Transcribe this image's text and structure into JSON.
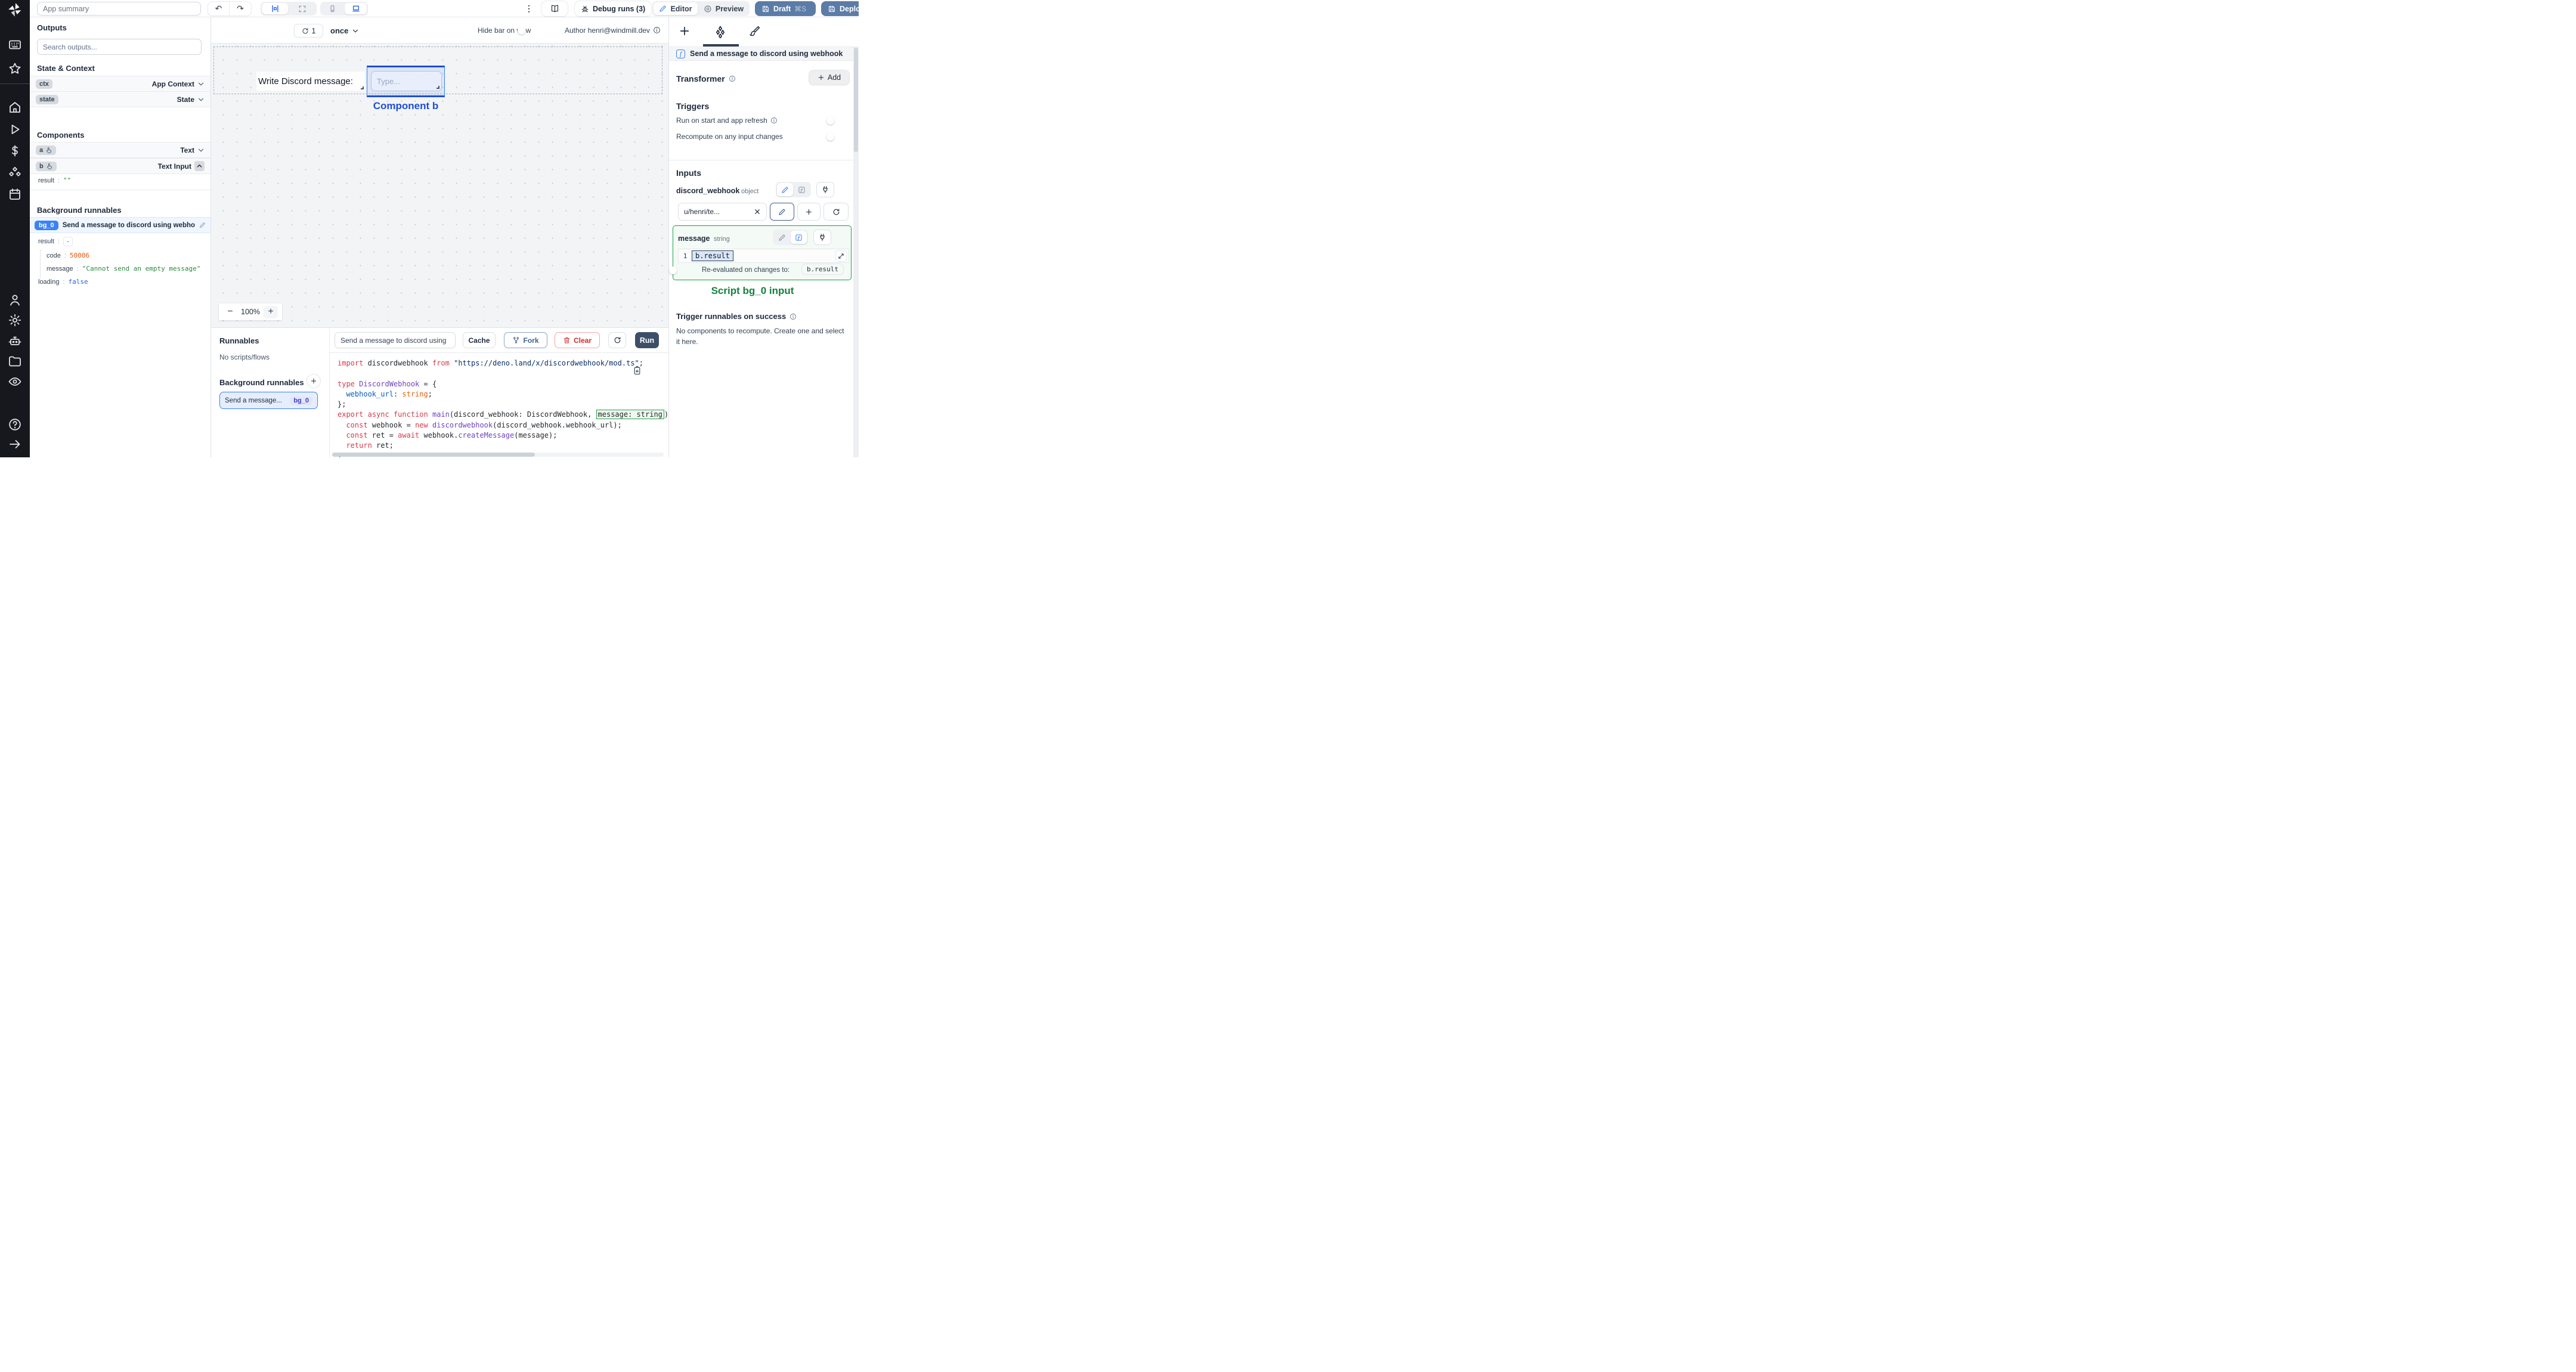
{
  "colors": {
    "accent_blue": "#2563eb",
    "selection_blue": "#1d4ed8",
    "success_green": "#15803d",
    "draft_deploy_button": "#5b7ca6",
    "run_button": "#3d4f68",
    "error_orange": "#e8590c",
    "string_green": "#2b8a3e",
    "bool_blue": "#2563eb",
    "badge_blue": "#3b82f6",
    "sidebar_bg": "#16181d"
  },
  "sidebar": {
    "icons": [
      "windmill-logo",
      "keyboard",
      "star",
      "home",
      "play",
      "dollar",
      "cubes",
      "calendar",
      "person",
      "gear",
      "robot",
      "folder",
      "eye",
      "help",
      "arrow-right"
    ]
  },
  "topbar": {
    "app_summary_placeholder": "App summary",
    "debug_runs_label": "Debug runs (3)",
    "editor_label": "Editor",
    "preview_label": "Preview",
    "draft_label": "Draft",
    "draft_shortcut": "⌘S",
    "deploy_label": "Deploy"
  },
  "outputs": {
    "title": "Outputs",
    "search_placeholder": "Search outputs...",
    "state_context_title": "State & Context",
    "ctx_badge": "ctx",
    "ctx_type": "App Context",
    "state_badge": "state",
    "state_type": "State",
    "components_title": "Components",
    "comp_a_badge": "a",
    "comp_a_type": "Text",
    "comp_b_badge": "b",
    "comp_b_type": "Text Input",
    "comp_b_result_key": "result",
    "comp_b_result_value": "\"\"",
    "background_title": "Background runnables",
    "bg0_badge": "bg_0",
    "bg0_name": "Send a message to discord using webhook",
    "bg0_result_key": "result",
    "bg0_collapse": "-",
    "bg0_code_key": "code",
    "bg0_code_value": "50006",
    "bg0_message_key": "message",
    "bg0_message_value": "\"Cannot send an empty message\"",
    "bg0_loading_key": "loading",
    "bg0_loading_value": "false"
  },
  "canvas": {
    "refresh_count": "1",
    "frequency": "once",
    "hide_bar_label": "Hide bar on view",
    "author_label": "Author henri@windmill.dev",
    "text_component_value": "Write Discord message:",
    "input_placeholder": "Type...",
    "selected_component_label": "Component b",
    "zoom_minus": "−",
    "zoom_level": "100%",
    "zoom_plus": "+"
  },
  "runnables": {
    "title": "Runnables",
    "empty_label": "No scripts/flows",
    "background_title": "Background runnables",
    "item_name": "Send a message...",
    "item_badge": "bg_0"
  },
  "script_editor": {
    "name_value": "Send a message to discord using",
    "cache_label": "Cache",
    "fork_label": "Fork",
    "clear_label": "Clear",
    "run_label": "Run",
    "code_lines": [
      [
        [
          "k",
          "import"
        ],
        [
          "p",
          " discordwebhook "
        ],
        [
          "k",
          "from"
        ],
        [
          "p",
          " "
        ],
        [
          "s",
          "\"https://deno.land/x/discordwebhook/mod.ts\""
        ],
        [
          "p",
          ";"
        ]
      ],
      [],
      [
        [
          "k",
          "type"
        ],
        [
          "p",
          " "
        ],
        [
          "v",
          "DiscordWebhook"
        ],
        [
          "p",
          " = {"
        ]
      ],
      [
        [
          "p",
          "  "
        ],
        [
          "b",
          "webhook_url"
        ],
        [
          "p",
          ": "
        ],
        [
          "t",
          "string"
        ],
        [
          "p",
          ";"
        ]
      ],
      [
        [
          "p",
          "};"
        ]
      ],
      [
        [
          "k",
          "export"
        ],
        [
          "p",
          " "
        ],
        [
          "k",
          "async"
        ],
        [
          "p",
          " "
        ],
        [
          "k",
          "function"
        ],
        [
          "p",
          " "
        ],
        [
          "v",
          "main"
        ],
        [
          "p",
          "(discord_webhook: DiscordWebhook, "
        ],
        [
          "box",
          "message: string"
        ],
        [
          "p",
          ") {"
        ]
      ],
      [
        [
          "p",
          "  "
        ],
        [
          "k",
          "const"
        ],
        [
          "p",
          " webhook = "
        ],
        [
          "k",
          "new"
        ],
        [
          "p",
          " "
        ],
        [
          "v",
          "discordwebhook"
        ],
        [
          "p",
          "(discord_webhook.webhook_url);"
        ]
      ],
      [
        [
          "p",
          "  "
        ],
        [
          "k",
          "const"
        ],
        [
          "p",
          " ret = "
        ],
        [
          "k",
          "await"
        ],
        [
          "p",
          " webhook."
        ],
        [
          "v",
          "createMessage"
        ],
        [
          "p",
          "(message);"
        ]
      ],
      [
        [
          "p",
          "  "
        ],
        [
          "k",
          "return"
        ],
        [
          "p",
          " ret;"
        ]
      ],
      [
        [
          "p",
          "}"
        ]
      ]
    ]
  },
  "settings": {
    "header_title": "Send a message to discord using webhook",
    "transformer_label": "Transformer",
    "add_label": "Add",
    "triggers_title": "Triggers",
    "trigger_run_on_start": "Run on start and app refresh",
    "trigger_recompute": "Recompute on any input changes",
    "inputs_title": "Inputs",
    "input1_name": "discord_webhook",
    "input1_type": "object",
    "input1_value": "u/henri/te...",
    "input2_name": "message",
    "input2_type": "string",
    "expr_line_no": "1",
    "expr_value": "b.result",
    "reeval_label": "Re-evaluated on changes to:",
    "reeval_target": "b.result",
    "script_input_label": "Script bg_0 input",
    "on_success_title": "Trigger runnables on success",
    "on_success_text": "No components to recompute. Create one and select it here."
  }
}
